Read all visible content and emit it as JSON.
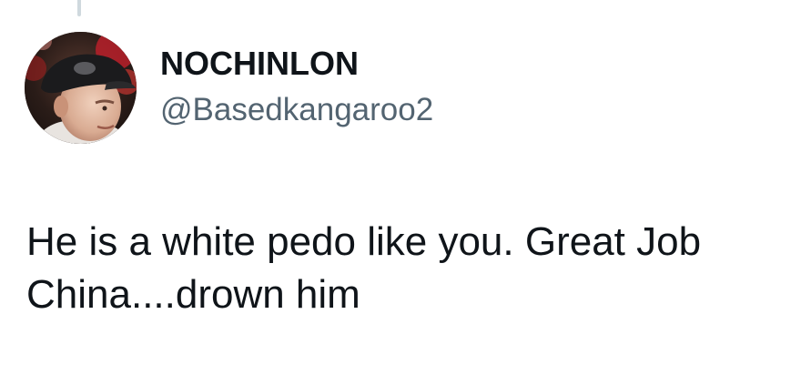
{
  "tweet": {
    "author": {
      "display_name": "NOCHINLON",
      "handle": "@Basedkangaroo2",
      "avatar_icon": "profile-photo"
    },
    "text": "He is a white pedo like you. Great Job China....drown him"
  },
  "colors": {
    "text_primary": "#0f1419",
    "text_secondary": "#536471",
    "thread_line": "#cfd9de",
    "background": "#ffffff"
  }
}
